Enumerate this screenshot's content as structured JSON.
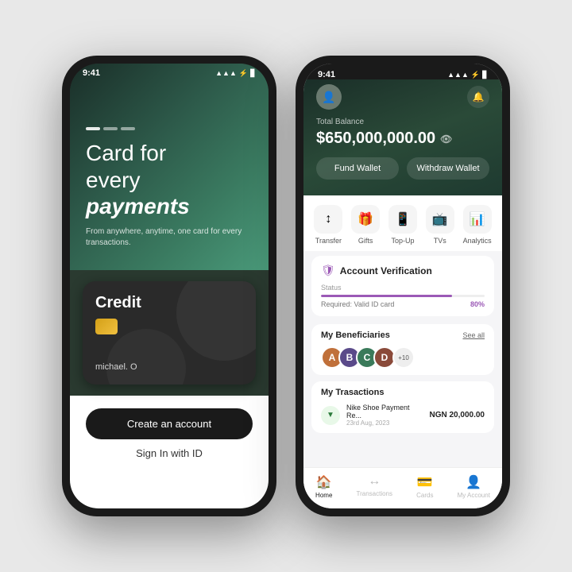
{
  "phone1": {
    "status": {
      "time": "9:41",
      "signal": "▲▲▲",
      "wifi": "WiFi",
      "battery": "🔋"
    },
    "hero": {
      "title_line1": "Card for",
      "title_line2": "every",
      "title_line3": "payments",
      "subtitle": "From anywhere, anytime, one card\nfor every transactions.",
      "dots": [
        true,
        false,
        false
      ]
    },
    "card": {
      "label": "Credit",
      "owner": "michael. O"
    },
    "actions": {
      "create_account": "Create an account",
      "sign_in": "Sign In with ID"
    }
  },
  "phone2": {
    "status": {
      "time": "9:41"
    },
    "header": {
      "balance_label": "Total Balance",
      "balance": "$650,000,000.00",
      "fund_wallet": "Fund Wallet",
      "withdraw_wallet": "Withdraw Wallet"
    },
    "quick_actions": [
      {
        "icon": "↕",
        "label": "Transfer"
      },
      {
        "icon": "🎁",
        "label": "Gifts"
      },
      {
        "icon": "📱",
        "label": "Top-Up"
      },
      {
        "icon": "📺",
        "label": "TVs"
      },
      {
        "icon": "📊",
        "label": "Analytics"
      }
    ],
    "verification": {
      "title": "Account Verification",
      "status_label": "Status",
      "required_label": "Required:",
      "required_value": "Valid ID card",
      "percent": "80%",
      "progress": 80
    },
    "beneficiaries": {
      "title": "My Beneficiaries",
      "see_all": "See all",
      "count": "+10",
      "avatars": [
        "#e07850",
        "#c05030",
        "#a03820",
        "#904028"
      ]
    },
    "transactions": {
      "title": "My Trasactions",
      "items": [
        {
          "name": "Nike Shoe Payment Re...",
          "date": "23rd Aug, 2023",
          "amount": "NGN 20,000.00",
          "direction": "down"
        }
      ]
    },
    "nav": [
      {
        "icon": "🏠",
        "label": "Home",
        "active": true
      },
      {
        "icon": "↔",
        "label": "Transactions",
        "active": false
      },
      {
        "icon": "💳",
        "label": "Cards",
        "active": false
      },
      {
        "icon": "👤",
        "label": "My Account",
        "active": false
      }
    ]
  }
}
